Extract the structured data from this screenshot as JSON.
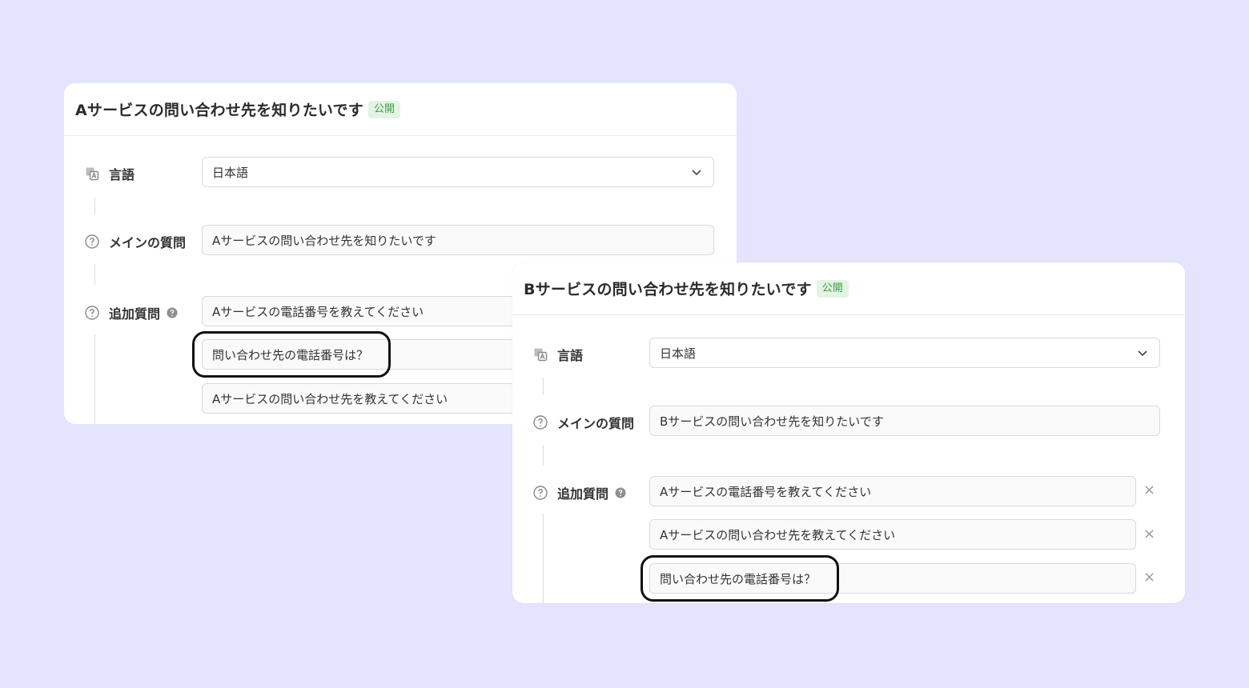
{
  "card_a": {
    "title": "Aサービスの問い合わせ先を知りたいです",
    "badge": "公開",
    "language_label": "言語",
    "language_value": "日本語",
    "main_question_label": "メインの質問",
    "main_question_value": "Aサービスの問い合わせ先を知りたいです",
    "additional_label": "追加質問",
    "additional_questions": [
      "Aサービスの電話番号を教えてください",
      "問い合わせ先の電話番号は？",
      "Aサービスの問い合わせ先を教えてください"
    ]
  },
  "card_b": {
    "title": "Bサービスの問い合わせ先を知りたいです",
    "badge": "公開",
    "language_label": "言語",
    "language_value": "日本語",
    "main_question_label": "メインの質問",
    "main_question_value": "Bサービスの問い合わせ先を知りたいです",
    "additional_label": "追加質問",
    "additional_questions": [
      "Aサービスの電話番号を教えてください",
      "Aサービスの問い合わせ先を教えてください",
      "問い合わせ先の電話番号は？"
    ],
    "remove_symbol": "×"
  },
  "icons": {
    "language": "translate-icon",
    "question": "question-circle-icon",
    "help": "help-filled-icon",
    "dropdown": "chevron-down-icon",
    "remove": "close-icon"
  },
  "colors": {
    "background": "#e4e4fe",
    "badge_bg": "#e3f3e4",
    "badge_text": "#3f9b48"
  }
}
